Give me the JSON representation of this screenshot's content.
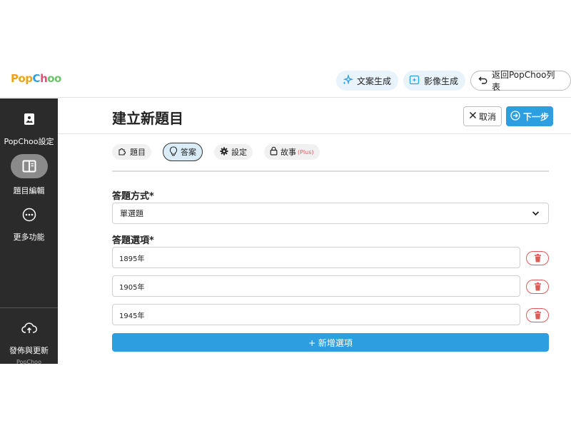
{
  "brand": {
    "logo_parts": [
      "Pop",
      "C",
      "h",
      "oo"
    ]
  },
  "topbar": {
    "text_gen_label": "文案生成",
    "image_gen_label": "影像生成",
    "back_label": "返回PopChoo列表"
  },
  "sidebar": {
    "items": [
      {
        "label": "PopChoo設定",
        "icon": "image-icon"
      },
      {
        "label": "題目編輯",
        "icon": "book-icon"
      },
      {
        "label": "更多功能",
        "icon": "more-icon"
      }
    ],
    "publish_label": "發佈與更新",
    "footer_text": "PopChoo"
  },
  "header": {
    "title": "建立新題目",
    "cancel_label": "取消",
    "next_label": "下一步"
  },
  "tabs": [
    {
      "label": "題目",
      "icon": "puzzle-icon"
    },
    {
      "label": "答案",
      "icon": "bulb-icon",
      "active": true
    },
    {
      "label": "設定",
      "icon": "gear-icon"
    },
    {
      "label": "故事",
      "icon": "lock-icon",
      "badge": "(Plus)"
    }
  ],
  "form": {
    "answer_type_label": "答題方式*",
    "answer_type_value": "單選題",
    "options_label": "答題選項*",
    "options": [
      "1895年",
      "1905年",
      "1945年"
    ],
    "add_option_label": "+ 新增選項"
  },
  "colors": {
    "accent": "#2d9ee0",
    "danger": "#e05a5a",
    "sidebar": "#2b2b2b"
  }
}
